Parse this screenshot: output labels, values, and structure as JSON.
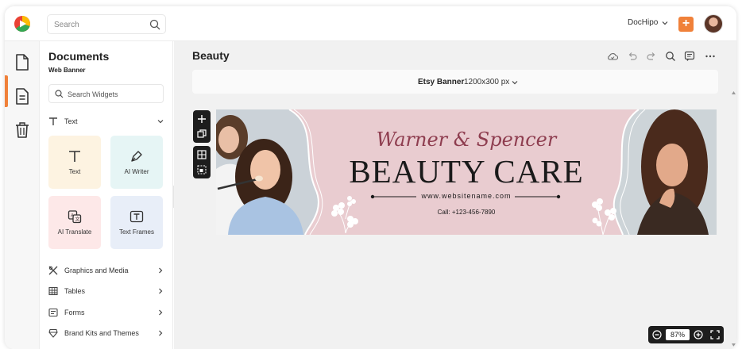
{
  "topbar": {
    "search_placeholder": "Search",
    "account_name": "DocHipo",
    "colors": {
      "accent": "#f0813a"
    }
  },
  "rail": {
    "items": [
      {
        "name": "new-document",
        "icon": "file-icon"
      },
      {
        "name": "documents",
        "icon": "document-icon",
        "active": true
      },
      {
        "name": "trash",
        "icon": "trash-icon"
      }
    ]
  },
  "panel": {
    "title": "Documents",
    "subtitle": "Web Banner",
    "search_placeholder": "Search Widgets",
    "text_section": "Text",
    "tiles": [
      {
        "label": "Text",
        "icon": "text-icon",
        "color": "#fdf3e1"
      },
      {
        "label": "AI Writer",
        "icon": "pen-icon",
        "color": "#e6f5f5"
      },
      {
        "label": "AI Translate",
        "icon": "translate-icon",
        "color": "#fde8e8"
      },
      {
        "label": "Text Frames",
        "icon": "text-frame-icon",
        "color": "#e8eef8"
      }
    ],
    "categories": [
      {
        "label": "Graphics and Media",
        "icon": "graphics-icon"
      },
      {
        "label": "Tables",
        "icon": "table-icon"
      },
      {
        "label": "Forms",
        "icon": "form-icon"
      },
      {
        "label": "Brand Kits and Themes",
        "icon": "brand-icon"
      }
    ]
  },
  "main": {
    "doc_title": "Beauty",
    "size_name": "Etsy Banner",
    "size_dims": "1200x300 px",
    "toolbar": [
      "cloud-save-icon",
      "undo-icon",
      "redo-icon",
      "search-icon",
      "comment-icon",
      "more-icon"
    ],
    "zoom": "87%"
  },
  "banner": {
    "title": "Warner & Spencer",
    "heading": "BEAUTY CARE",
    "website": "www.websitename.com",
    "phone": "Call: +123-456-7890",
    "colors": {
      "background": "#e9ccd0",
      "title": "#8e3d4f"
    }
  }
}
